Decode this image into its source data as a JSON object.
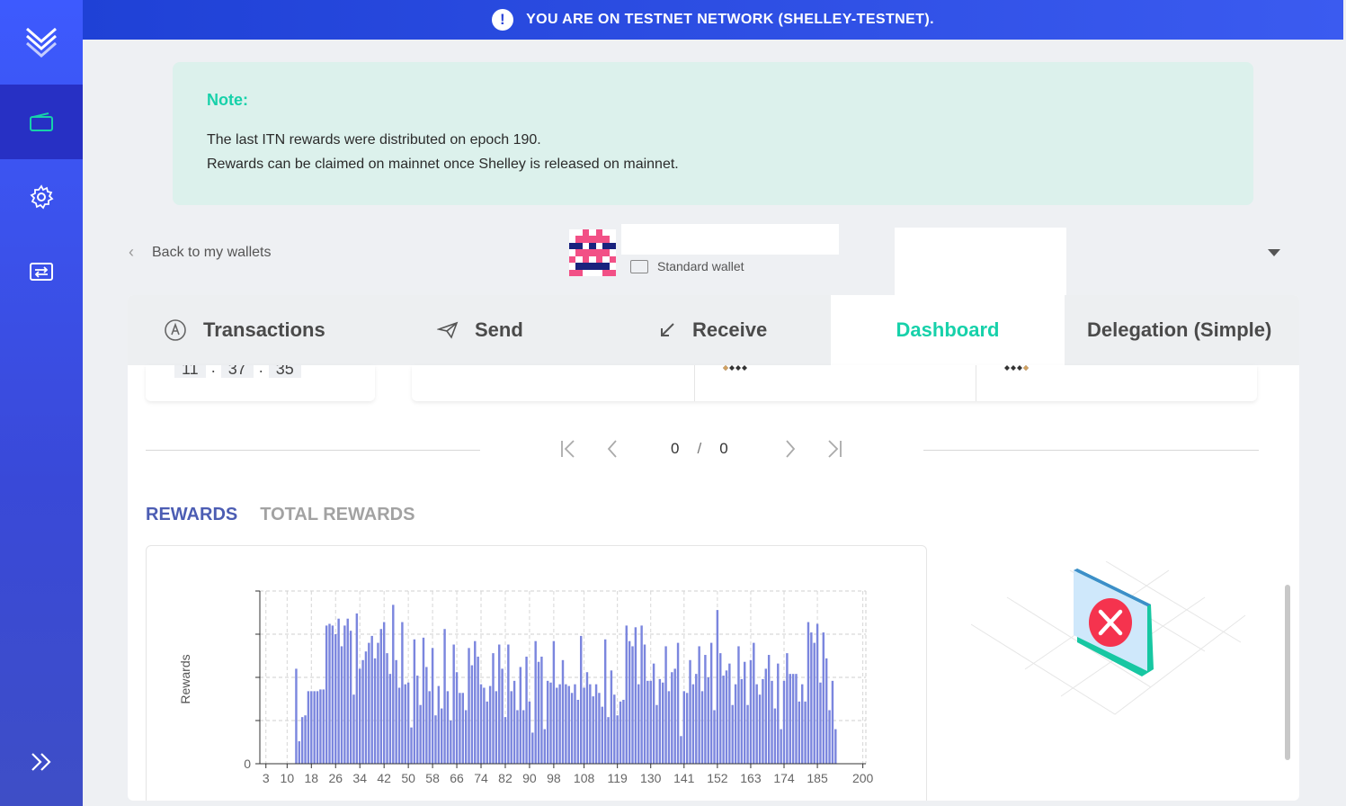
{
  "banner": {
    "text": "YOU ARE ON TESTNET NETWORK (SHELLEY-TESTNET)."
  },
  "sidebar": {
    "items": [
      {
        "name": "wallets",
        "icon": "wallet-icon",
        "active": true
      },
      {
        "name": "settings",
        "icon": "gear-icon",
        "active": false
      },
      {
        "name": "transfer",
        "icon": "transfer-icon",
        "active": false
      }
    ],
    "expand_icon": "double-chevron-right-icon"
  },
  "note": {
    "title": "Note:",
    "line1": "The last ITN rewards were distributed on epoch 190.",
    "line2": "Rewards can be claimed on mainnet once Shelley is released on mainnet."
  },
  "header": {
    "back_label": "Back to my wallets",
    "wallet_type": "Standard wallet"
  },
  "tabs": [
    {
      "label": "Transactions",
      "icon": "transactions-icon"
    },
    {
      "label": "Send",
      "icon": "send-icon"
    },
    {
      "label": "Receive",
      "icon": "receive-icon"
    },
    {
      "label": "Dashboard",
      "active": true
    },
    {
      "label": "Delegation (Simple)"
    }
  ],
  "clock": {
    "h": "11",
    "m": "37",
    "s": "35"
  },
  "pager": {
    "current": "0",
    "separator": "/",
    "total": "0"
  },
  "reward_tabs": {
    "rewards": "REWARDS",
    "total_rewards": "TOTAL REWARDS"
  },
  "colors": {
    "accent": "#17d1aa",
    "bar": "#7b86de",
    "brand": "#3d5afe"
  },
  "chart_data": {
    "type": "bar",
    "title": "",
    "xlabel": "",
    "ylabel": "Rewards",
    "y_ticks": [
      "0"
    ],
    "x_ticks": [
      "3",
      "10",
      "18",
      "26",
      "34",
      "42",
      "50",
      "58",
      "66",
      "74",
      "82",
      "90",
      "98",
      "108",
      "119",
      "130",
      "141",
      "152",
      "163",
      "174",
      "185",
      "200"
    ],
    "x_range": [
      1,
      201
    ],
    "grid": true,
    "ylim": [
      0,
      100
    ],
    "values": [
      0,
      0,
      0,
      0,
      0,
      0,
      0,
      0,
      0,
      0,
      0,
      0,
      55,
      13,
      27,
      28,
      42,
      42,
      42,
      42,
      43,
      43,
      80,
      81,
      80,
      75,
      84,
      68,
      80,
      84,
      77,
      40,
      87,
      55,
      60,
      65,
      70,
      74,
      61,
      70,
      78,
      82,
      64,
      52,
      92,
      60,
      44,
      82,
      46,
      47,
      21,
      72,
      51,
      34,
      73,
      56,
      42,
      67,
      28,
      45,
      32,
      78,
      42,
      25,
      69,
      53,
      41,
      41,
      31,
      67,
      57,
      71,
      62,
      46,
      44,
      36,
      45,
      64,
      42,
      69,
      55,
      27,
      69,
      42,
      48,
      31,
      56,
      31,
      62,
      36,
      18,
      71,
      59,
      62,
      20,
      48,
      47,
      71,
      44,
      46,
      60,
      46,
      45,
      41,
      46,
      37,
      74,
      44,
      53,
      46,
      39,
      46,
      41,
      33,
      72,
      27,
      54,
      40,
      28,
      36,
      37,
      80,
      71,
      68,
      79,
      46,
      80,
      69,
      48,
      48,
      58,
      34,
      49,
      47,
      68,
      42,
      53,
      55,
      70,
      16,
      42,
      41,
      60,
      46,
      52,
      68,
      42,
      63,
      50,
      70,
      31,
      89,
      64,
      51,
      54,
      58,
      34,
      46,
      68,
      49,
      59,
      34,
      60,
      70,
      46,
      40,
      49,
      55,
      63,
      48,
      32,
      58,
      20,
      48,
      64,
      52,
      52,
      52,
      36,
      46,
      36,
      82,
      76,
      70,
      81,
      47,
      76,
      61,
      31,
      48,
      20,
      0,
      0,
      0,
      0,
      0,
      0,
      0,
      0,
      0,
      0,
      0
    ]
  }
}
